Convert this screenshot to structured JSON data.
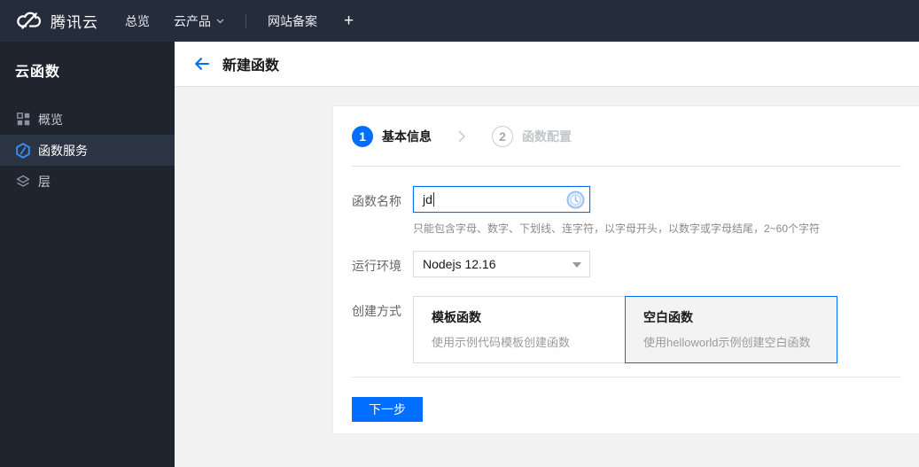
{
  "colors": {
    "accent": "#006eff",
    "navbar_bg": "#252d3c",
    "sidebar_bg": "#1f242f",
    "page_bg": "#f2f2f2"
  },
  "topnav": {
    "brand": "腾讯云",
    "items": [
      {
        "label": "总览"
      },
      {
        "label": "云产品"
      },
      {
        "label": "网站备案"
      }
    ],
    "plus_label": "+"
  },
  "sidebar": {
    "title": "云函数",
    "items": [
      {
        "label": "概览",
        "icon": "grid-icon",
        "selected": false
      },
      {
        "label": "函数服务",
        "icon": "function-hexagon-icon",
        "selected": true
      },
      {
        "label": "层",
        "icon": "layers-icon",
        "selected": false
      }
    ]
  },
  "header": {
    "title": "新建函数"
  },
  "wizard": {
    "steps": [
      {
        "number": "1",
        "label": "基本信息",
        "active": true
      },
      {
        "number": "2",
        "label": "函数配置",
        "active": false
      }
    ]
  },
  "form": {
    "name": {
      "label": "函数名称",
      "value": "jd",
      "hint": "只能包含字母、数字、下划线、连字符，以字母开头，以数字或字母结尾，2~60个字符"
    },
    "runtime": {
      "label": "运行环境",
      "value": "Nodejs 12.16"
    },
    "method": {
      "label": "创建方式",
      "options": [
        {
          "title": "模板函数",
          "desc": "使用示例代码模板创建函数",
          "selected": false
        },
        {
          "title": "空白函数",
          "desc": "使用helloworld示例创建空白函数",
          "selected": true
        }
      ]
    }
  },
  "actions": {
    "next_label": "下一步"
  }
}
